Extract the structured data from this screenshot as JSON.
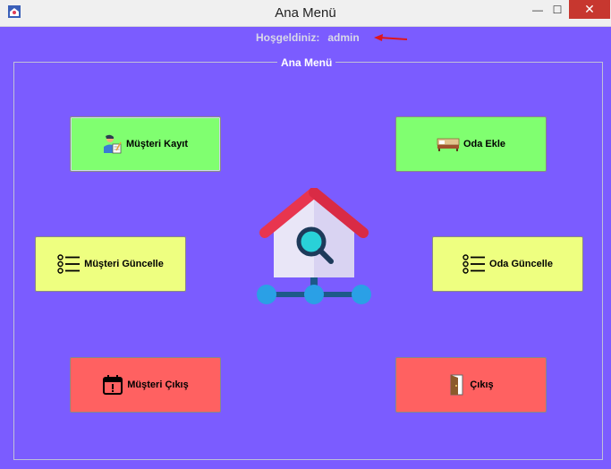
{
  "window": {
    "title": "Ana Menü",
    "close_glyph": "✕",
    "min_glyph": "—",
    "max_glyph": "☐"
  },
  "welcome": {
    "label": "Hoşgeldiniz:",
    "user": "admin"
  },
  "group": {
    "legend": "Ana Menü"
  },
  "buttons": {
    "musteri_kayit": "Müşteri Kayıt",
    "oda_ekle": "Oda Ekle",
    "musteri_guncelle": "Müşteri Güncelle",
    "oda_guncelle": "Oda Güncelle",
    "musteri_cikis": "Müşteri Çıkış",
    "cikis": "Çıkış"
  },
  "colors": {
    "background": "#7b5cff",
    "green": "#80ff70",
    "yellow": "#eeff80",
    "red": "#ff6161"
  },
  "icons": [
    "app-house-icon",
    "user-form-icon",
    "bed-icon",
    "list-icon",
    "calendar-alert-icon",
    "door-exit-icon",
    "house-search-network-icon"
  ]
}
